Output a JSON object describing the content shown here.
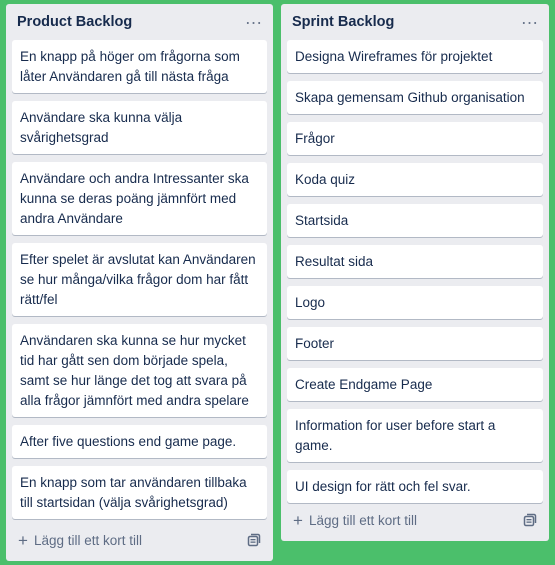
{
  "lists": [
    {
      "title": "Product Backlog",
      "menu": "…",
      "cards": [
        "En knapp på höger om frågorna som låter Användaren gå till nästa fråga",
        "Användare ska kunna välja svårighetsgrad",
        "Användare och andra Intressanter ska kunna se deras poäng jämnfört med andra Användare",
        "Efter spelet är avslutat kan Användaren se hur många/vilka frågor dom har fått rätt/fel",
        "Användaren ska kunna se hur mycket tid har gått sen dom började spela, samt se hur länge det tog att svara på alla frågor jämnfört med andra spelare",
        "After five questions end game page.",
        "En knapp som tar användaren tillbaka till startsidan (välja svårighetsgrad)"
      ],
      "add_label": "Lägg till ett kort till"
    },
    {
      "title": "Sprint Backlog",
      "menu": "…",
      "cards": [
        "Designa Wireframes för projektet",
        "Skapa gemensam Github organisation",
        "Frågor",
        "Koda quiz",
        "Startsida",
        "Resultat sida",
        "Logo",
        "Footer",
        "Create Endgame Page",
        "Information for user before start a game.",
        "UI design for rätt och fel svar."
      ],
      "add_label": "Lägg till ett kort till"
    }
  ],
  "colors": {
    "board_background": "#4bbf6b",
    "list_background": "#ebecf0",
    "card_background": "#ffffff",
    "text": "#172b4d",
    "muted_text": "#5e6c84"
  },
  "icons": {
    "menu": "more-horizontal-icon",
    "add": "plus-icon",
    "template": "card-template-icon"
  }
}
